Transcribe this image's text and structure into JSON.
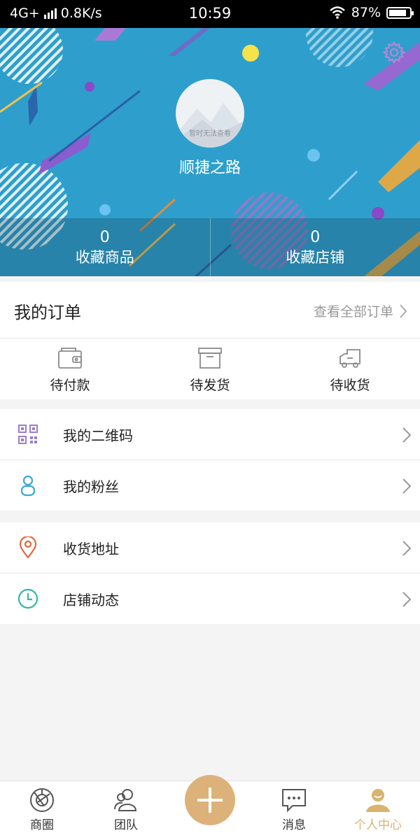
{
  "status_bar": {
    "network": "4G+",
    "speed": "0.8K/s",
    "time": "10:59",
    "battery": "87%",
    "battery_level": 0.87
  },
  "profile": {
    "avatar_caption": "暂时无法查看",
    "username": "顺捷之路",
    "settings_icon": "gear-icon",
    "stats": [
      {
        "value": "0",
        "label": "收藏商品"
      },
      {
        "value": "0",
        "label": "收藏店铺"
      }
    ]
  },
  "orders": {
    "title": "我的订单",
    "view_all": "查看全部订单",
    "items": [
      {
        "label": "待付款",
        "icon": "wallet-icon"
      },
      {
        "label": "待发货",
        "icon": "box-icon"
      },
      {
        "label": "待收货",
        "icon": "truck-icon"
      }
    ]
  },
  "menu": {
    "group1": [
      {
        "label": "我的二维码",
        "icon": "qrcode-icon"
      },
      {
        "label": "我的粉丝",
        "icon": "person-icon"
      }
    ],
    "group2": [
      {
        "label": "收货地址",
        "icon": "location-icon"
      },
      {
        "label": "店铺动态",
        "icon": "clock-icon"
      }
    ]
  },
  "tabbar": {
    "tabs": [
      {
        "label": "商圈",
        "icon": "aperture-icon"
      },
      {
        "label": "团队",
        "icon": "team-icon"
      },
      {
        "label": "消息",
        "icon": "chat-icon"
      },
      {
        "label": "个人中心",
        "icon": "user-icon",
        "active": true
      }
    ],
    "center_icon": "plus-icon"
  },
  "colors": {
    "header_blue": "#2e9fcc",
    "accent_gold": "#dcb27a",
    "active_tab": "#d9b46e"
  }
}
